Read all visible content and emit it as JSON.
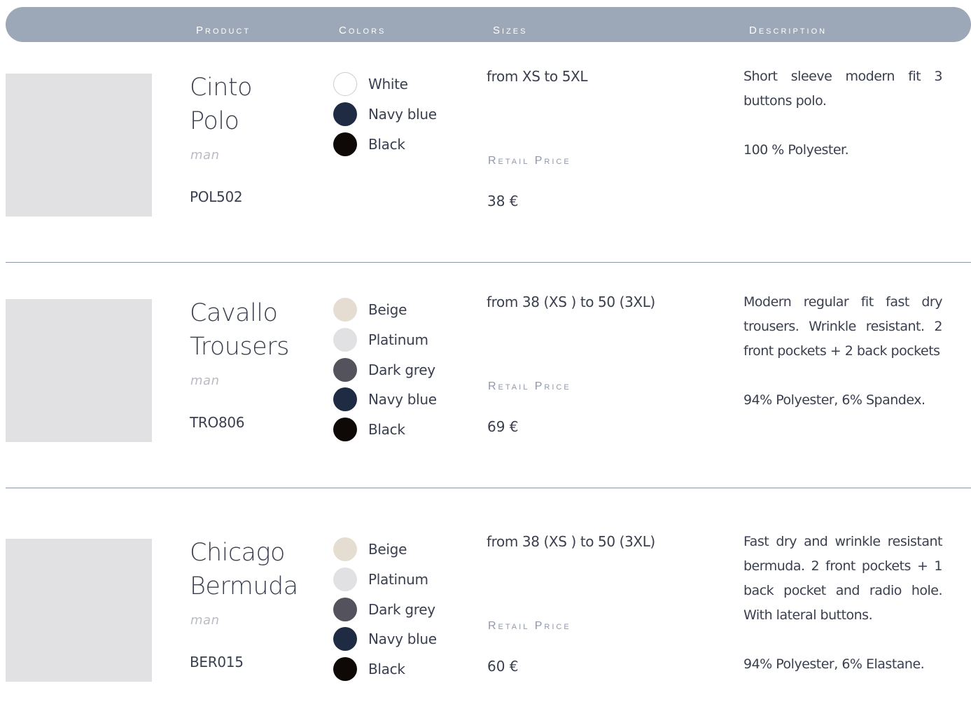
{
  "header": {
    "product": "Product",
    "colors": "Colors",
    "sizes": "Sizes",
    "description": "Description"
  },
  "products": [
    {
      "name_line1": "Cinto",
      "name_line2": "Polo",
      "gender": "man",
      "code": "POL502",
      "colors": [
        {
          "label": "White",
          "hex": "#ffffff"
        },
        {
          "label": "Navy blue",
          "hex": "#1f2b42"
        },
        {
          "label": "Black",
          "hex": "#0e0806"
        }
      ],
      "sizes": "from XS to 5XL",
      "price_label": "Retail Price",
      "price": "38 €",
      "description": "Short sleeve modern fit 3 buttons polo.",
      "composition": "100 % Polyester."
    },
    {
      "name_line1": "Cavallo",
      "name_line2": "Trousers",
      "gender": "man",
      "code": "TRO806",
      "colors": [
        {
          "label": "Beige",
          "hex": "#e6ddd2"
        },
        {
          "label": "Platinum",
          "hex": "#e1e0e3"
        },
        {
          "label": "Dark grey",
          "hex": "#53525d"
        },
        {
          "label": "Navy blue",
          "hex": "#1f2b42"
        },
        {
          "label": "Black",
          "hex": "#0e0806"
        }
      ],
      "sizes": "from 38 (XS ) to 50 (3XL)",
      "price_label": "Retail Price",
      "price": "69 €",
      "description": "Modern regular fit fast dry trousers. Wrinkle resistant. 2 front pockets + 2 back pockets",
      "composition": "94% Polyester, 6% Spandex."
    },
    {
      "name_line1": "Chicago",
      "name_line2": "Bermuda",
      "gender": "man",
      "code": "BER015",
      "colors": [
        {
          "label": "Beige",
          "hex": "#e6ddd2"
        },
        {
          "label": "Platinum",
          "hex": "#e1e0e3"
        },
        {
          "label": "Dark grey",
          "hex": "#53525d"
        },
        {
          "label": "Navy blue",
          "hex": "#1f2b42"
        },
        {
          "label": "Black",
          "hex": "#0e0806"
        }
      ],
      "sizes": "from 38 (XS ) to 50 (3XL)",
      "price_label": "Retail Price",
      "price": "60 €",
      "description": "Fast dry and wrinkle resistant bermuda. 2 front pockets + 1 back pocket and radio hole. With lateral buttons.",
      "composition": "94% Polyester, 6% Elastane."
    }
  ]
}
